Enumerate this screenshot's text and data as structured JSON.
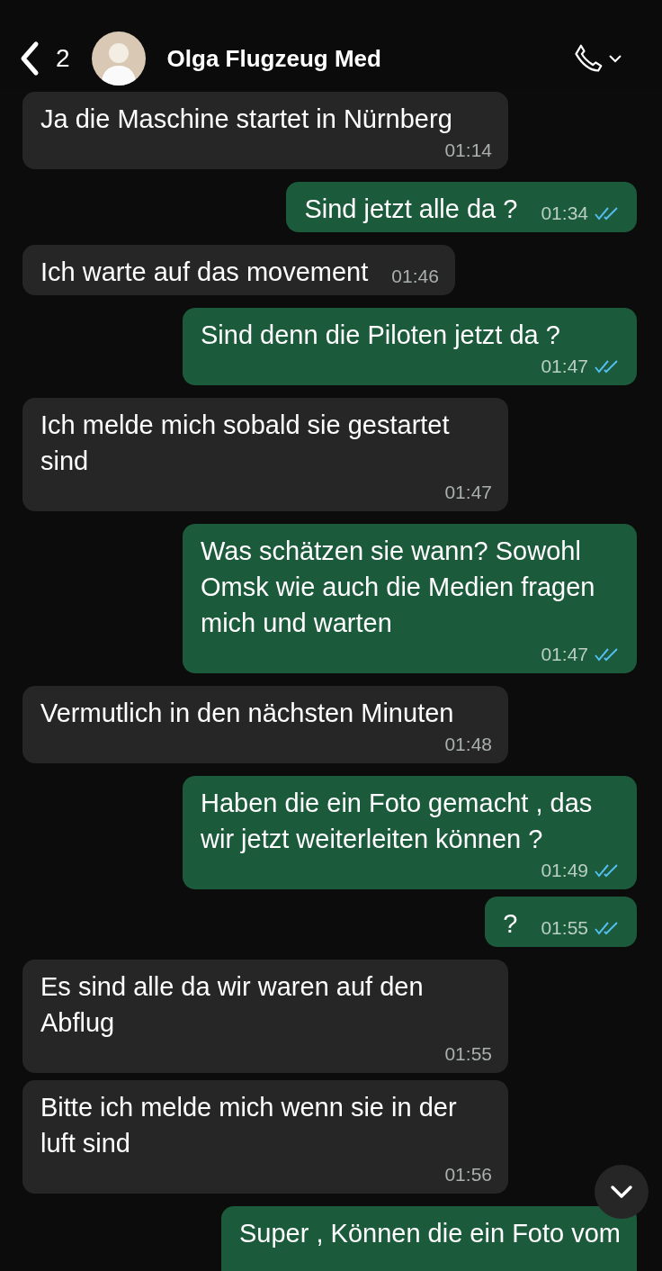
{
  "header": {
    "back_count": "2",
    "contact_name": "Olga Flugzeug Med"
  },
  "messages": [
    {
      "kind": "incoming",
      "text": "Ja die Maschine startet in Nürnberg",
      "time": "01:14"
    },
    {
      "kind": "outgoing",
      "text": "Sind jetzt alle da ?",
      "time": "01:34",
      "read": true
    },
    {
      "kind": "incoming",
      "text": "Ich warte auf das movement",
      "time": "01:46"
    },
    {
      "kind": "outgoing",
      "text": "Sind denn die Piloten jetzt da ?",
      "time": "01:47",
      "read": true
    },
    {
      "kind": "incoming",
      "text": "Ich melde mich sobald sie gestartet sind",
      "time": "01:47"
    },
    {
      "kind": "outgoing",
      "text": "Was schätzen sie wann? Sowohl Omsk wie auch die Medien fragen mich und warten",
      "time": "01:47",
      "read": true
    },
    {
      "kind": "incoming",
      "text": "Vermutlich in den nächsten Minuten",
      "time": "01:48"
    },
    {
      "kind": "outgoing",
      "text": "Haben die ein Foto gemacht , das wir jetzt weiterleiten können ?",
      "time": "01:49",
      "read": true
    },
    {
      "kind": "outgoing",
      "text": "?",
      "time": "01:55",
      "read": true
    },
    {
      "kind": "incoming",
      "text": "Es sind alle da wir waren auf den Abflug",
      "time": "01:55"
    },
    {
      "kind": "incoming",
      "text": "Bitte ich melde mich wenn sie in der luft sind",
      "time": "01:56"
    },
    {
      "kind": "outgoing",
      "text": "Super , Können die ein Foto vom"
    }
  ]
}
